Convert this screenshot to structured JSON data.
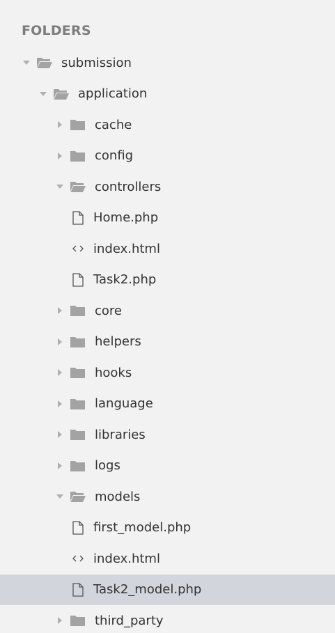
{
  "sidebar": {
    "title": "FOLDERS",
    "items": [
      {
        "label": "submission",
        "type": "folder",
        "expanded": true,
        "depth": 0
      },
      {
        "label": "application",
        "type": "folder",
        "expanded": true,
        "depth": 1
      },
      {
        "label": "cache",
        "type": "folder",
        "expanded": false,
        "depth": 2
      },
      {
        "label": "config",
        "type": "folder",
        "expanded": false,
        "depth": 2
      },
      {
        "label": "controllers",
        "type": "folder",
        "expanded": true,
        "depth": 2
      },
      {
        "label": "Home.php",
        "type": "file",
        "icon": "file-icon",
        "depth": 3
      },
      {
        "label": "index.html",
        "type": "file",
        "icon": "code-icon",
        "depth": 3
      },
      {
        "label": "Task2.php",
        "type": "file",
        "icon": "file-icon",
        "depth": 3
      },
      {
        "label": "core",
        "type": "folder",
        "expanded": false,
        "depth": 2
      },
      {
        "label": "helpers",
        "type": "folder",
        "expanded": false,
        "depth": 2
      },
      {
        "label": "hooks",
        "type": "folder",
        "expanded": false,
        "depth": 2
      },
      {
        "label": "language",
        "type": "folder",
        "expanded": false,
        "depth": 2
      },
      {
        "label": "libraries",
        "type": "folder",
        "expanded": false,
        "depth": 2
      },
      {
        "label": "logs",
        "type": "folder",
        "expanded": false,
        "depth": 2
      },
      {
        "label": "models",
        "type": "folder",
        "expanded": true,
        "depth": 2
      },
      {
        "label": "first_model.php",
        "type": "file",
        "icon": "file-icon",
        "depth": 3
      },
      {
        "label": "index.html",
        "type": "file",
        "icon": "code-icon",
        "depth": 3
      },
      {
        "label": "Task2_model.php",
        "type": "file",
        "icon": "file-icon",
        "depth": 3,
        "selected": true
      },
      {
        "label": "third_party",
        "type": "folder",
        "expanded": false,
        "depth": 2
      }
    ]
  },
  "colors": {
    "background": "#f2f2f2",
    "selected_row": "#d2d5db",
    "folder_icon": "#a3a3a3",
    "arrow": "#b0b0b0",
    "text": "#333333",
    "title": "#7d7d7d"
  }
}
